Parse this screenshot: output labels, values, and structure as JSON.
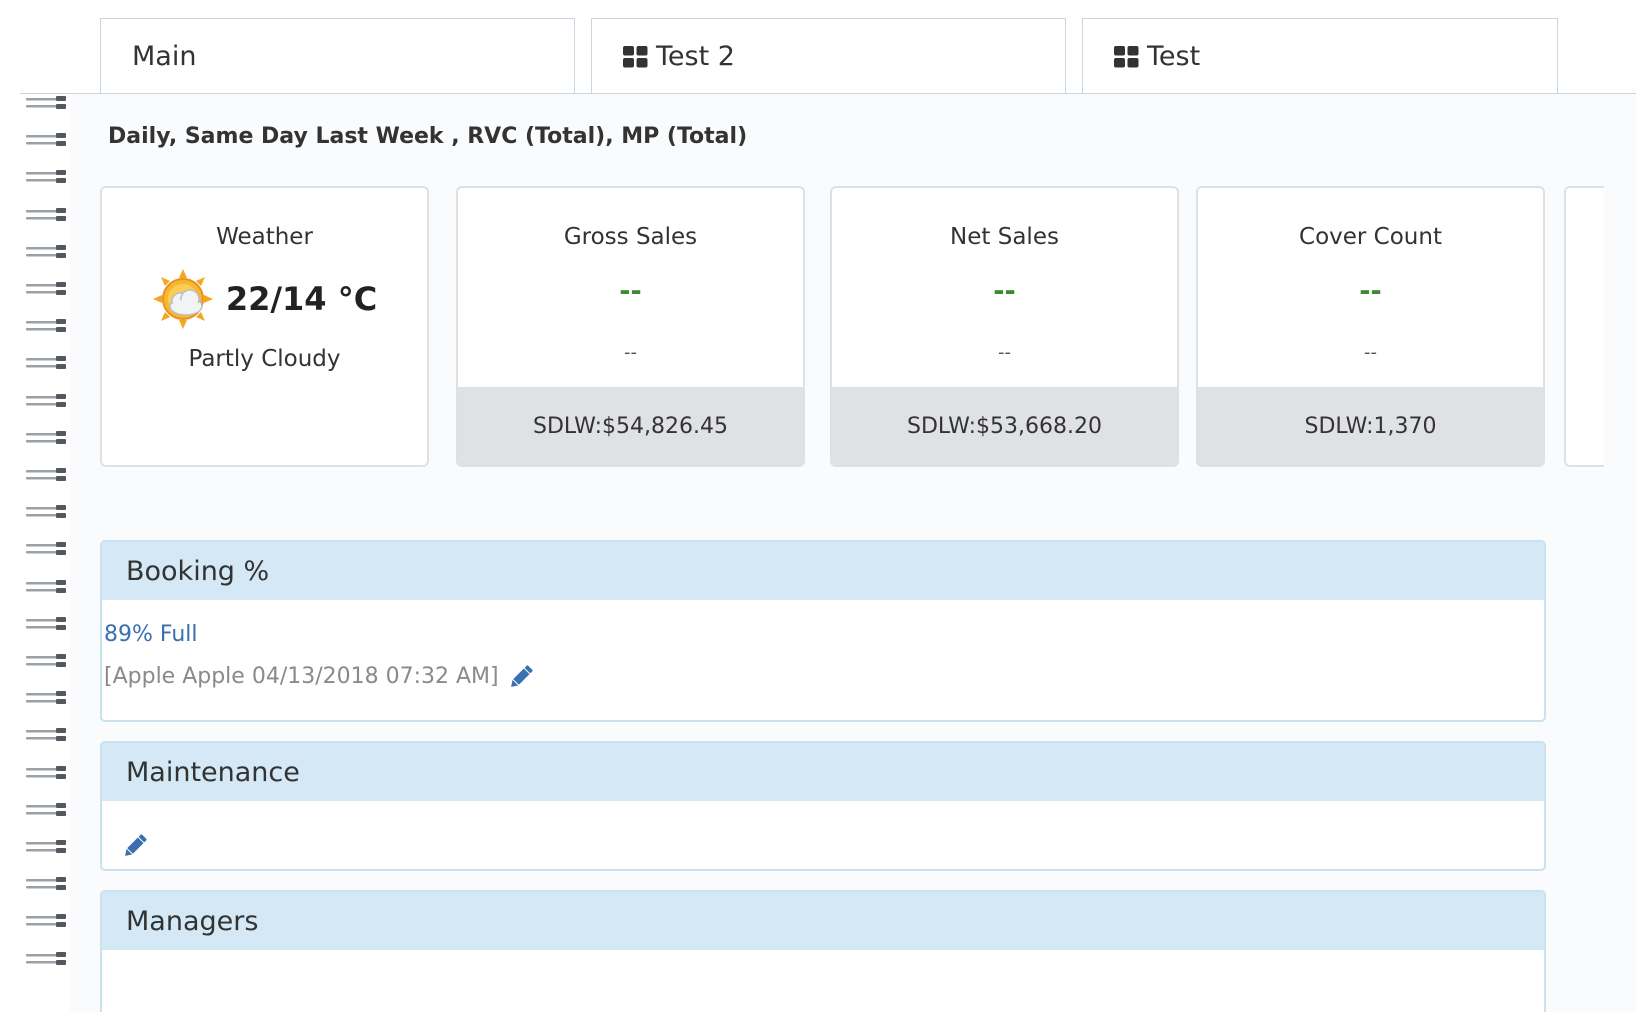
{
  "tabs": [
    {
      "label": "Main",
      "icon": null
    },
    {
      "label": "Test 2",
      "icon": "grid-icon"
    },
    {
      "label": "Test",
      "icon": "grid-icon"
    }
  ],
  "report": {
    "subtitle": "Daily, Same Day Last Week , RVC (Total), MP (Total)"
  },
  "cards": {
    "weather": {
      "title": "Weather",
      "temperature": "22/14 °C",
      "condition": "Partly Cloudy",
      "icon": "partly-cloudy-icon"
    },
    "gross_sales": {
      "title": "Gross Sales",
      "value": "--",
      "sub": "--",
      "footer": "SDLW:$54,826.45"
    },
    "net_sales": {
      "title": "Net Sales",
      "value": "--",
      "sub": "--",
      "footer": "SDLW:$53,668.20"
    },
    "cover_count": {
      "title": "Cover Count",
      "value": "--",
      "sub": "--",
      "footer": "SDLW:1,370"
    }
  },
  "panels": {
    "booking": {
      "title": "Booking %",
      "link": "89% Full",
      "meta": "[Apple Apple 04/13/2018 07:32 AM]"
    },
    "maintenance": {
      "title": "Maintenance"
    },
    "managers": {
      "title": "Managers"
    }
  },
  "colors": {
    "accent_blue": "#3a6fb0",
    "value_green": "#3b8a2f",
    "panel_header": "#d4e9f5"
  }
}
